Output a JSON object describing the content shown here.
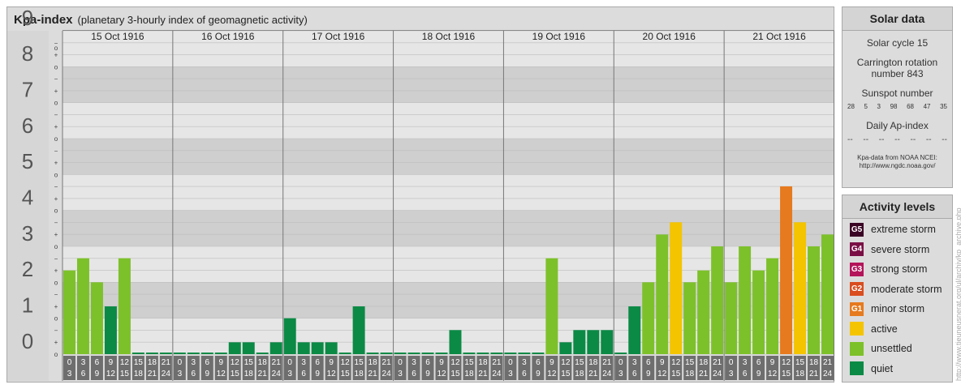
{
  "header": {
    "title": "Kpa-index",
    "subtitle": "(planetary 3-hourly index of geomagnetic activity)"
  },
  "chart_data": {
    "type": "bar",
    "ylim": [
      0,
      9
    ],
    "y_ticks": [
      "0",
      "1",
      "2",
      "3",
      "4",
      "5",
      "6",
      "7",
      "8",
      "9"
    ],
    "minor_ticks": [
      "o",
      "+",
      "−"
    ],
    "days": [
      "15 Oct 1916",
      "16 Oct 1916",
      "17 Oct 1916",
      "18 Oct 1916",
      "19 Oct 1916",
      "20 Oct 1916",
      "21 Oct 1916"
    ],
    "interval_labels": [
      [
        "0",
        "3"
      ],
      [
        "3",
        "6"
      ],
      [
        "6",
        "9"
      ],
      [
        "9",
        "12"
      ],
      [
        "12",
        "15"
      ],
      [
        "15",
        "18"
      ],
      [
        "18",
        "21"
      ],
      [
        "21",
        "24"
      ]
    ],
    "values": [
      [
        2.33,
        2.67,
        2.0,
        1.33,
        2.67,
        0,
        0,
        0
      ],
      [
        0,
        0,
        0,
        0,
        0.33,
        0.33,
        0,
        0.33
      ],
      [
        1.0,
        0.33,
        0.33,
        0.33,
        0,
        1.33,
        0,
        0
      ],
      [
        0,
        0,
        0,
        0,
        0.67,
        0,
        0,
        0
      ],
      [
        0,
        0,
        0,
        2.67,
        0.33,
        0.67,
        0.67,
        0.67
      ],
      [
        0,
        1.33,
        2.0,
        3.33,
        3.67,
        2.0,
        2.33,
        3.0
      ],
      [
        2.0,
        3.0,
        2.33,
        2.67,
        4.67,
        3.67,
        3.0,
        3.33
      ]
    ],
    "colors": {
      "quiet": "#0b8a45",
      "unsettled": "#7dc12a",
      "active": "#f4c400",
      "G1": "#e67a1e",
      "G2": "#d94d1f",
      "G3": "#b4145a",
      "G4": "#7a0f45",
      "G5": "#3a0424",
      "zero": "#0b8a45"
    }
  },
  "solar": {
    "title": "Solar data",
    "cycle": "Solar cycle 15",
    "carrington_1": "Carrington rotation",
    "carrington_2": "number 843",
    "sunspot_label": "Sunspot number",
    "sunspots": [
      "28",
      "5",
      "3",
      "98",
      "68",
      "47",
      "35"
    ],
    "ap_label": "Daily Ap-index",
    "ap_values": [
      "--",
      "--",
      "--",
      "--",
      "--",
      "--",
      "--"
    ],
    "source_1": "Kpa-data from NOAA NCEI:",
    "source_2": "http://www.ngdc.noaa.gov/"
  },
  "activity": {
    "title": "Activity levels",
    "items": [
      {
        "code": "G5",
        "label": "extreme storm",
        "color": "#3a0424"
      },
      {
        "code": "G4",
        "label": "severe storm",
        "color": "#7a0f45"
      },
      {
        "code": "G3",
        "label": "strong storm",
        "color": "#b4145a"
      },
      {
        "code": "G2",
        "label": "moderate storm",
        "color": "#d94d1f"
      },
      {
        "code": "G1",
        "label": "minor storm",
        "color": "#e67a1e"
      },
      {
        "code": "",
        "label": "active",
        "color": "#f4c400"
      },
      {
        "code": "",
        "label": "unsettled",
        "color": "#7dc12a"
      },
      {
        "code": "",
        "label": "quiet",
        "color": "#0b8a45"
      }
    ]
  },
  "watermark": "http://www.tieuneusnerat.org/ul/archiv/kp_archive.php"
}
